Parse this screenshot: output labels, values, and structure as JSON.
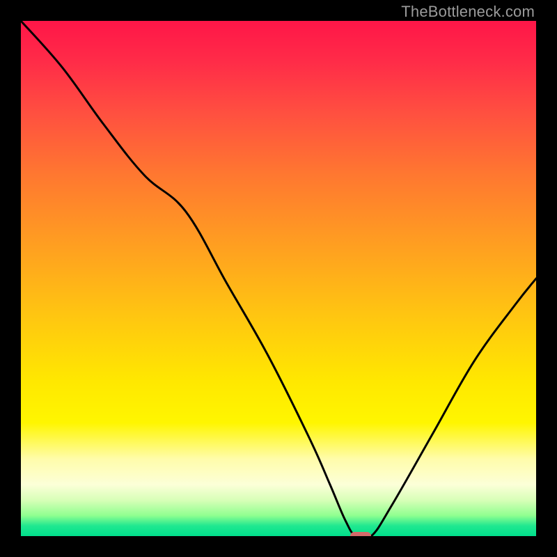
{
  "watermark": "TheBottleneck.com",
  "chart_data": {
    "type": "line",
    "title": "",
    "xlabel": "",
    "ylabel": "",
    "xlim": [
      0,
      100
    ],
    "ylim": [
      0,
      100
    ],
    "grid": false,
    "legend": null,
    "series": [
      {
        "name": "bottleneck-curve",
        "x": [
          0,
          8,
          16,
          24,
          32,
          40,
          48,
          56,
          60,
          63,
          65,
          68,
          72,
          80,
          88,
          96,
          100
        ],
        "y": [
          100,
          91,
          80,
          70,
          63,
          49,
          35,
          19,
          10,
          3,
          0,
          0,
          6,
          20,
          34,
          45,
          50
        ]
      }
    ],
    "marker": {
      "x": 66,
      "y": 0
    },
    "background_gradient_stops": [
      {
        "pos": 0,
        "color": "#ff1648"
      },
      {
        "pos": 50,
        "color": "#ffc810"
      },
      {
        "pos": 78,
        "color": "#fff600"
      },
      {
        "pos": 100,
        "color": "#00e08c"
      }
    ]
  }
}
